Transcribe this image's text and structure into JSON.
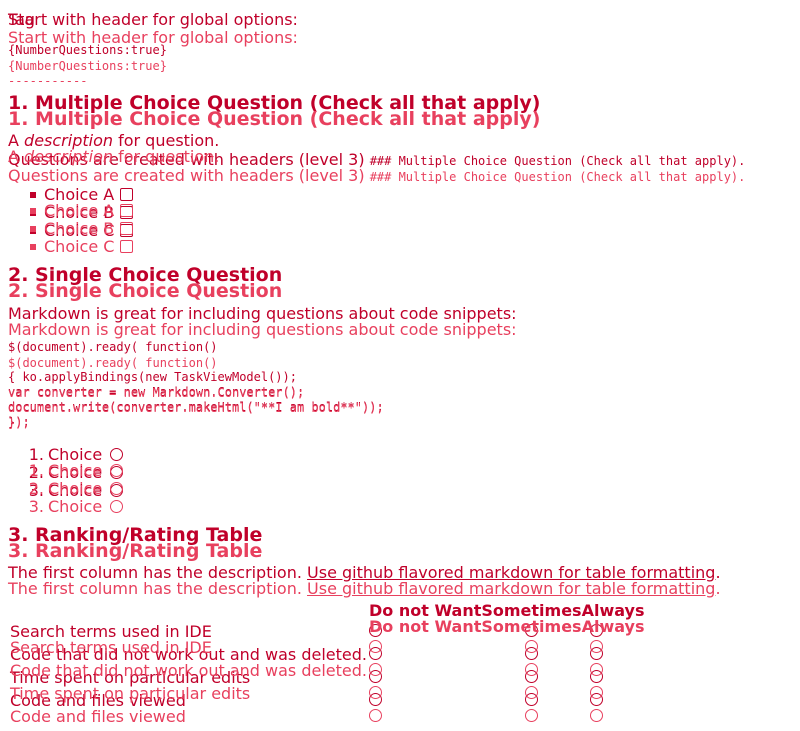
{
  "form": {
    "title": "Tag",
    "header_text": "Start with header for global options:",
    "global_options": "{NumberQuestions:true}",
    "title_underline": "-----------"
  },
  "q1": {
    "heading": "1. Multiple Choice Question (Check all that apply)",
    "description_prefix": "A ",
    "description_em": "description",
    "description_suffix": " for question.",
    "note": "Questions are created with headers (level 3)",
    "note_code": "### Multiple Choice Question (Check all that apply).",
    "choices": [
      "Choice A",
      "Choice B",
      "Choice C"
    ]
  },
  "q2": {
    "heading": "2. Single Choice Question",
    "intro": "Markdown is great for including questions about code snippets:",
    "code": [
      "$(document).ready( function()",
      "{    ko.applyBindings(new TaskViewModel());",
      "     var converter = new Markdown.Converter();",
      "     document.write(converter.makeHtml(\"**I am bold**\"));",
      "});"
    ],
    "choices": [
      {
        "num": "1.",
        "label": "Choice"
      },
      {
        "num": "2.",
        "label": "Choice"
      },
      {
        "num": "3.",
        "label": "Choice"
      }
    ]
  },
  "q3": {
    "heading": "3. Ranking/Rating Table",
    "intro": "The first column has the description. ",
    "link": "Use github flavored markdown for table formatting",
    "intro_end": ".",
    "columns": [
      "Do not Want",
      "Sometimes",
      "Always"
    ],
    "rows": [
      "Search terms used in IDE",
      "Code that did not work out and was deleted.",
      "Time spent on particular edits",
      "Code and files viewed"
    ]
  },
  "colors": {
    "primary": "#c0002a",
    "ghost": "#e8405e"
  }
}
